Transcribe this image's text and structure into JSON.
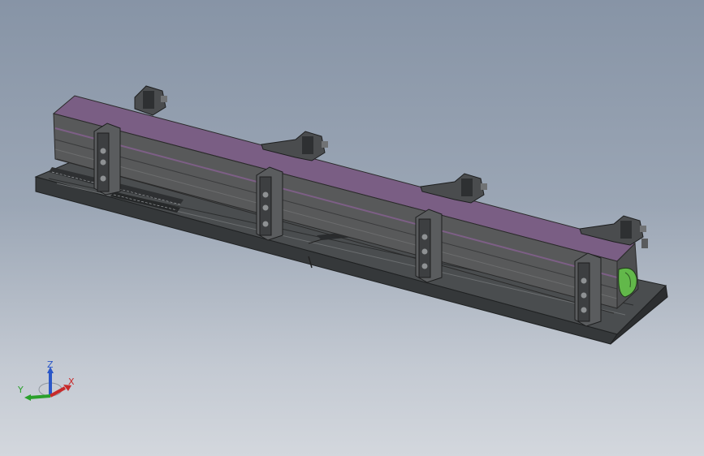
{
  "viewport": {
    "background_top": "#8794a6",
    "background_bottom": "#d3d7dd"
  },
  "model": {
    "description_icon": "cad-assembly-icon",
    "colors": {
      "beam_top": "#7d5f86",
      "beam_side": "#5c5e60",
      "frame_dark": "#3f4244",
      "frame_mid": "#5f6264",
      "end_cap": "#62b84a"
    },
    "clamps_front_count": 4,
    "clamps_back_count": 4
  },
  "triad": {
    "z_label": "Z",
    "x_label": "X",
    "y_label": "Y",
    "z_color": "#2a57c8",
    "x_color": "#c82a2a",
    "y_color": "#2aa02a"
  }
}
